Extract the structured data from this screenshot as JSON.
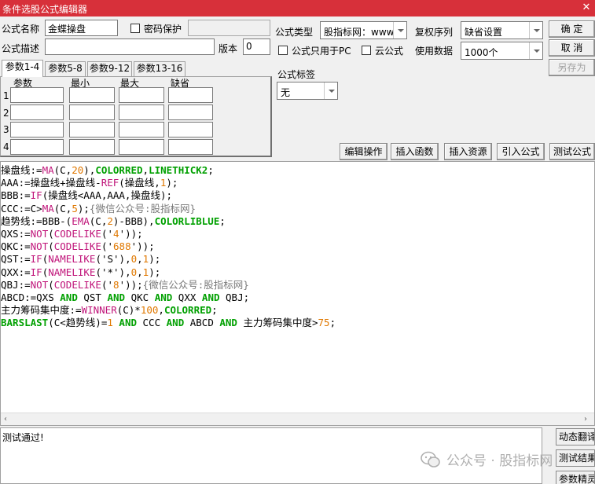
{
  "window": {
    "title": "条件选股公式编辑器"
  },
  "form": {
    "name_label": "公式名称",
    "name_value": "金蝶操盘",
    "password_label": "密码保护",
    "desc_label": "公式描述",
    "version_label": "版本",
    "version_value": "0",
    "type_label": "公式类型",
    "type_value": "股指标网：www",
    "order_label": "复权序列",
    "order_value": "缺省设置",
    "pc_only_label": "公式只用于PC",
    "cloud_label": "云公式",
    "data_label": "使用数据",
    "data_value": "1000个",
    "tag_label": "公式标签",
    "tag_value": "无"
  },
  "buttons": {
    "ok": "确 定",
    "cancel": "取 消",
    "save_as": "另存为",
    "edit_ops": "编辑操作",
    "insert_func": "插入函数",
    "insert_res": "插入资源",
    "import": "引入公式",
    "test": "测试公式"
  },
  "tabs": [
    "参数1-4",
    "参数5-8",
    "参数9-12",
    "参数13-16"
  ],
  "params": {
    "headers": [
      "参数",
      "最小",
      "最大",
      "缺省"
    ],
    "rows": [
      "1",
      "2",
      "3",
      "4"
    ]
  },
  "code_lines": [
    [
      {
        "t": "操盘线:=",
        "c": ""
      },
      {
        "t": "MA",
        "c": "fn"
      },
      {
        "t": "(C,",
        "c": ""
      },
      {
        "t": "20",
        "c": "num"
      },
      {
        "t": "),",
        "c": ""
      },
      {
        "t": "COLORRED",
        "c": "kw"
      },
      {
        "t": ",",
        "c": ""
      },
      {
        "t": "LINETHICK2",
        "c": "kw"
      },
      {
        "t": ";",
        "c": ""
      }
    ],
    [
      {
        "t": "AAA:=操盘线+操盘线-",
        "c": ""
      },
      {
        "t": "REF",
        "c": "fn"
      },
      {
        "t": "(操盘线,",
        "c": ""
      },
      {
        "t": "1",
        "c": "num"
      },
      {
        "t": ");",
        "c": ""
      }
    ],
    [
      {
        "t": "BBB:=",
        "c": ""
      },
      {
        "t": "IF",
        "c": "fn"
      },
      {
        "t": "(操盘线<AAA,AAA,操盘线);",
        "c": ""
      }
    ],
    [
      {
        "t": "CCC:=C>",
        "c": ""
      },
      {
        "t": "MA",
        "c": "fn"
      },
      {
        "t": "(C,",
        "c": ""
      },
      {
        "t": "5",
        "c": "num"
      },
      {
        "t": ");",
        "c": ""
      },
      {
        "t": "{微信公众号:股指标网}",
        "c": "cmt"
      }
    ],
    [
      {
        "t": "趋势线:=BBB-(",
        "c": ""
      },
      {
        "t": "EMA",
        "c": "fn"
      },
      {
        "t": "(C,",
        "c": ""
      },
      {
        "t": "2",
        "c": "num"
      },
      {
        "t": ")-BBB),",
        "c": ""
      },
      {
        "t": "COLORLIBLUE",
        "c": "kw"
      },
      {
        "t": ";",
        "c": ""
      }
    ],
    [
      {
        "t": "QXS:=",
        "c": ""
      },
      {
        "t": "NOT",
        "c": "fn"
      },
      {
        "t": "(",
        "c": ""
      },
      {
        "t": "CODELIKE",
        "c": "fn"
      },
      {
        "t": "('",
        "c": ""
      },
      {
        "t": "4",
        "c": "num"
      },
      {
        "t": "'));",
        "c": ""
      }
    ],
    [
      {
        "t": "QKC:=",
        "c": ""
      },
      {
        "t": "NOT",
        "c": "fn"
      },
      {
        "t": "(",
        "c": ""
      },
      {
        "t": "CODELIKE",
        "c": "fn"
      },
      {
        "t": "('",
        "c": ""
      },
      {
        "t": "688",
        "c": "num"
      },
      {
        "t": "'));",
        "c": ""
      }
    ],
    [
      {
        "t": "QST:=",
        "c": ""
      },
      {
        "t": "IF",
        "c": "fn"
      },
      {
        "t": "(",
        "c": ""
      },
      {
        "t": "NAMELIKE",
        "c": "fn"
      },
      {
        "t": "('S'),",
        "c": ""
      },
      {
        "t": "0",
        "c": "num"
      },
      {
        "t": ",",
        "c": ""
      },
      {
        "t": "1",
        "c": "num"
      },
      {
        "t": ");",
        "c": ""
      }
    ],
    [
      {
        "t": "QXX:=",
        "c": ""
      },
      {
        "t": "IF",
        "c": "fn"
      },
      {
        "t": "(",
        "c": ""
      },
      {
        "t": "NAMELIKE",
        "c": "fn"
      },
      {
        "t": "('*'),",
        "c": ""
      },
      {
        "t": "0",
        "c": "num"
      },
      {
        "t": ",",
        "c": ""
      },
      {
        "t": "1",
        "c": "num"
      },
      {
        "t": ");",
        "c": ""
      }
    ],
    [
      {
        "t": "QBJ:=",
        "c": ""
      },
      {
        "t": "NOT",
        "c": "fn"
      },
      {
        "t": "(",
        "c": ""
      },
      {
        "t": "CODELIKE",
        "c": "fn"
      },
      {
        "t": "('",
        "c": ""
      },
      {
        "t": "8",
        "c": "num"
      },
      {
        "t": "'));",
        "c": ""
      },
      {
        "t": "{微信公众号:股指标网}",
        "c": "cmt"
      }
    ],
    [
      {
        "t": "ABCD:=QXS ",
        "c": ""
      },
      {
        "t": "AND",
        "c": "kw"
      },
      {
        "t": " QST ",
        "c": ""
      },
      {
        "t": "AND",
        "c": "kw"
      },
      {
        "t": " QKC ",
        "c": ""
      },
      {
        "t": "AND",
        "c": "kw"
      },
      {
        "t": " QXX ",
        "c": ""
      },
      {
        "t": "AND",
        "c": "kw"
      },
      {
        "t": " QBJ;",
        "c": ""
      }
    ],
    [
      {
        "t": "主力筹码集中度:=",
        "c": ""
      },
      {
        "t": "WINNER",
        "c": "fn"
      },
      {
        "t": "(C)*",
        "c": ""
      },
      {
        "t": "100",
        "c": "num"
      },
      {
        "t": ",",
        "c": ""
      },
      {
        "t": "COLORRED",
        "c": "kw"
      },
      {
        "t": ";",
        "c": ""
      }
    ],
    [
      {
        "t": "BARSLAST",
        "c": "kw"
      },
      {
        "t": "(C<趋势线)=",
        "c": ""
      },
      {
        "t": "1",
        "c": "num"
      },
      {
        "t": " ",
        "c": ""
      },
      {
        "t": "AND",
        "c": "kw"
      },
      {
        "t": " CCC ",
        "c": ""
      },
      {
        "t": "AND",
        "c": "kw"
      },
      {
        "t": " ABCD ",
        "c": ""
      },
      {
        "t": "AND",
        "c": "kw"
      },
      {
        "t": " 主力筹码集中度>",
        "c": ""
      },
      {
        "t": "75",
        "c": "num"
      },
      {
        "t": ";",
        "c": ""
      }
    ]
  ],
  "status": {
    "text": "测试通过!"
  },
  "side_buttons": [
    "动态翻译",
    "测试结果",
    "参数精灵"
  ],
  "watermark": "公众号 · 股指标网",
  "colors": {
    "titlebar": "#d7303a",
    "keyword": "#00a000",
    "function": "#c0157a",
    "number": "#e07800",
    "comment": "#7a7a7a"
  }
}
